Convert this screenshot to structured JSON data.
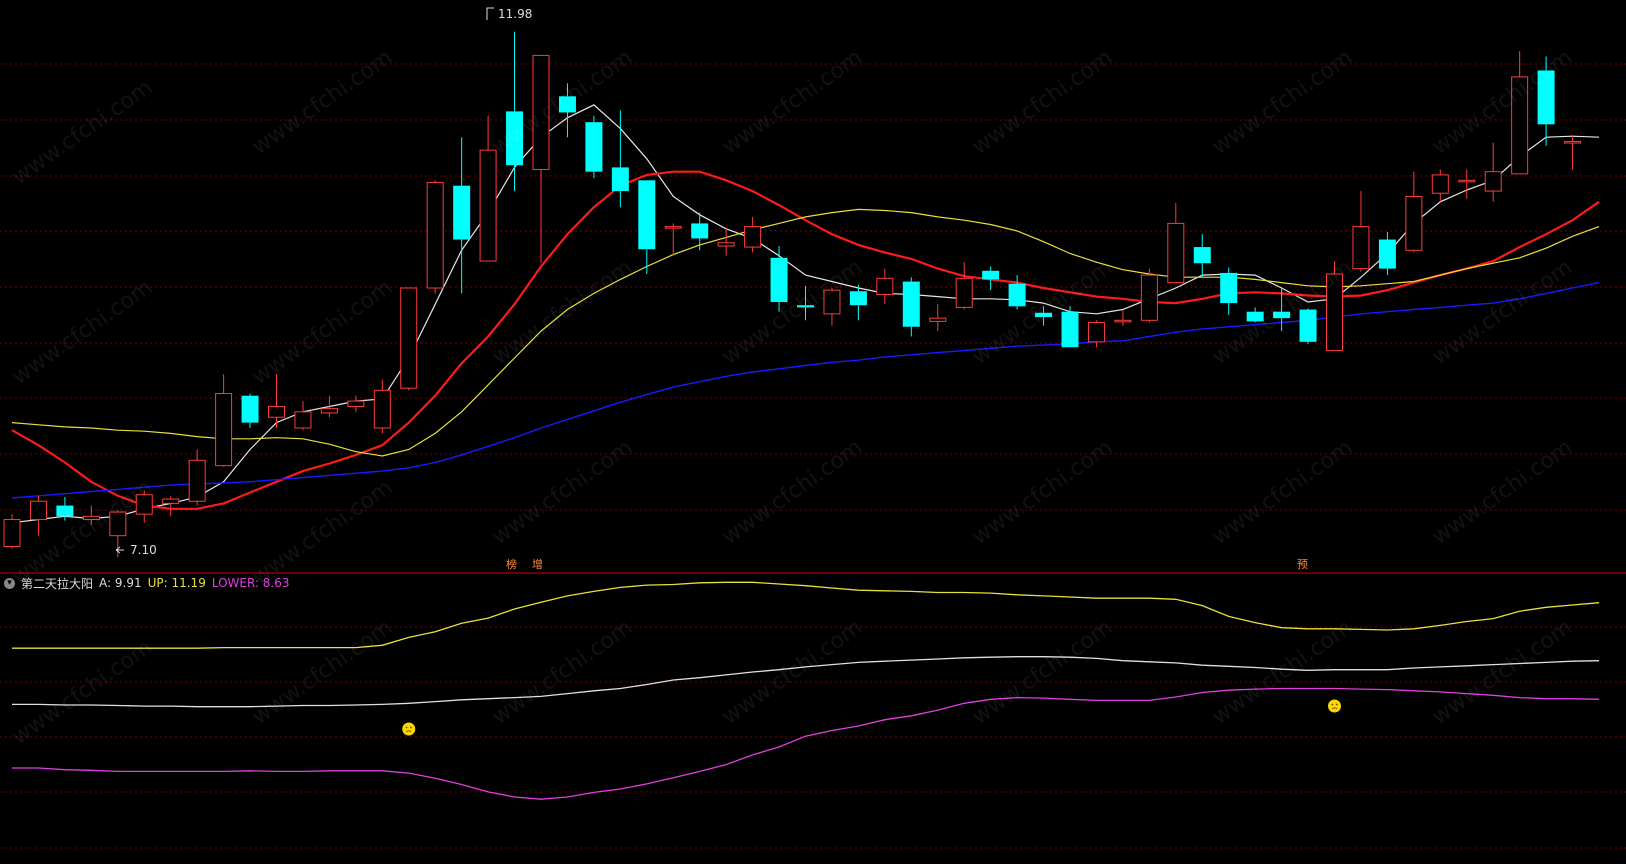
{
  "colors": {
    "background": "#000000",
    "up_candle": "#ff3b3b",
    "down_candle": "#00ffff",
    "ma_white": "#e6e6e6",
    "ma_red": "#ff1a1a",
    "ma_yellow": "#e8e03a",
    "ma_blue": "#1a1aff",
    "grid": "#7a0000",
    "divider": "#8b0000",
    "upper": "#e8e03a",
    "mid": "#e0e0e0",
    "lower": "#e040e0",
    "smiley": "#ffd700"
  },
  "annotations": {
    "high_label": "11.98",
    "low_label": "7.10"
  },
  "markers": [
    "榜",
    "增",
    "预"
  ],
  "indicator": {
    "name": "第二天拉大阳",
    "a_label": "A: 9.91",
    "up_label": "UP: 11.19",
    "lower_label": "LOWER: 8.63"
  },
  "watermark": "www.cfchi.com",
  "chart_data": [
    {
      "type": "candlestick",
      "ylim": [
        7.0,
        12.2
      ],
      "grid": true,
      "candles": [
        [
          7.2,
          7.45,
          7.18,
          7.5
        ],
        [
          7.45,
          7.62,
          7.3,
          7.67
        ],
        [
          7.58,
          7.48,
          7.44,
          7.66
        ],
        [
          7.45,
          7.48,
          7.4,
          7.58
        ],
        [
          7.3,
          7.52,
          7.1,
          7.54
        ],
        [
          7.5,
          7.68,
          7.42,
          7.72
        ],
        [
          7.6,
          7.64,
          7.48,
          7.67
        ],
        [
          7.62,
          8.0,
          7.58,
          8.1
        ],
        [
          7.95,
          8.62,
          7.94,
          8.8
        ],
        [
          8.6,
          8.35,
          8.3,
          8.62
        ],
        [
          8.4,
          8.5,
          8.3,
          8.8
        ],
        [
          8.3,
          8.45,
          8.28,
          8.55
        ],
        [
          8.44,
          8.48,
          8.4,
          8.6
        ],
        [
          8.5,
          8.55,
          8.45,
          8.6
        ],
        [
          8.3,
          8.65,
          8.25,
          8.75
        ],
        [
          8.67,
          9.6,
          8.65,
          9.6
        ],
        [
          9.6,
          10.58,
          9.55,
          10.6
        ],
        [
          10.55,
          10.05,
          9.55,
          11.0
        ],
        [
          9.85,
          10.88,
          9.85,
          11.2
        ],
        [
          11.24,
          10.74,
          10.5,
          11.98
        ],
        [
          10.7,
          11.76,
          9.83,
          11.76
        ],
        [
          11.38,
          11.23,
          11.0,
          11.5
        ],
        [
          11.14,
          10.68,
          10.62,
          11.2
        ],
        [
          10.72,
          10.5,
          10.35,
          11.25
        ],
        [
          10.6,
          9.96,
          9.73,
          10.6
        ],
        [
          10.17,
          10.17,
          9.9,
          10.2
        ],
        [
          10.2,
          10.06,
          9.95,
          10.3
        ],
        [
          9.99,
          10.02,
          9.9,
          10.15
        ],
        [
          9.98,
          10.17,
          9.93,
          10.26
        ],
        [
          9.88,
          9.47,
          9.38,
          9.99
        ],
        [
          9.44,
          9.42,
          9.3,
          9.62
        ],
        [
          9.36,
          9.58,
          9.25,
          9.6
        ],
        [
          9.57,
          9.44,
          9.3,
          9.63
        ],
        [
          9.54,
          9.69,
          9.45,
          9.78
        ],
        [
          9.66,
          9.24,
          9.15,
          9.7
        ],
        [
          9.29,
          9.32,
          9.2,
          9.45
        ],
        [
          9.42,
          9.69,
          9.4,
          9.84
        ],
        [
          9.76,
          9.68,
          9.58,
          9.8
        ],
        [
          9.64,
          9.43,
          9.4,
          9.72
        ],
        [
          9.37,
          9.33,
          9.25,
          9.43
        ],
        [
          9.38,
          9.05,
          9.05,
          9.43
        ],
        [
          9.1,
          9.28,
          9.05,
          9.3
        ],
        [
          9.29,
          9.3,
          9.25,
          9.39
        ],
        [
          9.3,
          9.72,
          9.28,
          9.78
        ],
        [
          9.65,
          10.2,
          9.64,
          10.39
        ],
        [
          9.98,
          9.83,
          9.7,
          10.1
        ],
        [
          9.74,
          9.46,
          9.35,
          9.79
        ],
        [
          9.38,
          9.29,
          9.28,
          9.42
        ],
        [
          9.38,
          9.32,
          9.2,
          9.6
        ],
        [
          9.4,
          9.1,
          9.08,
          9.41
        ],
        [
          9.02,
          9.73,
          9.02,
          9.85
        ],
        [
          9.78,
          10.17,
          9.75,
          10.5
        ],
        [
          10.05,
          9.78,
          9.72,
          10.12
        ],
        [
          9.95,
          10.45,
          9.93,
          10.68
        ],
        [
          10.48,
          10.65,
          10.4,
          10.7
        ],
        [
          10.6,
          10.6,
          10.43,
          10.7
        ],
        [
          10.5,
          10.68,
          10.4,
          10.95
        ],
        [
          10.66,
          11.56,
          10.66,
          11.8
        ],
        [
          11.62,
          11.12,
          10.92,
          11.75
        ],
        [
          10.96,
          10.96,
          10.7,
          11.02
        ]
      ],
      "series": [
        {
          "kind": "ma_white",
          "values": [
            7.42,
            7.45,
            7.48,
            7.46,
            7.48,
            7.55,
            7.6,
            7.66,
            7.8,
            8.1,
            8.35,
            8.45,
            8.5,
            8.55,
            8.57,
            8.95,
            9.45,
            9.95,
            10.3,
            10.72,
            11.0,
            11.18,
            11.3,
            11.08,
            10.8,
            10.45,
            10.28,
            10.15,
            10.06,
            9.9,
            9.72,
            9.66,
            9.6,
            9.55,
            9.54,
            9.52,
            9.5,
            9.5,
            9.49,
            9.46,
            9.38,
            9.36,
            9.4,
            9.5,
            9.6,
            9.72,
            9.73,
            9.72,
            9.6,
            9.47,
            9.5,
            9.7,
            9.92,
            10.2,
            10.4,
            10.51,
            10.6,
            10.82,
            11.0,
            11.01,
            11.0
          ]
        },
        {
          "kind": "ma_red",
          "values": [
            8.28,
            8.14,
            7.98,
            7.8,
            7.67,
            7.58,
            7.55,
            7.55,
            7.6,
            7.7,
            7.8,
            7.9,
            7.97,
            8.05,
            8.14,
            8.35,
            8.6,
            8.9,
            9.15,
            9.45,
            9.8,
            10.1,
            10.35,
            10.55,
            10.65,
            10.68,
            10.68,
            10.6,
            10.5,
            10.37,
            10.23,
            10.1,
            10.0,
            9.93,
            9.87,
            9.78,
            9.71,
            9.68,
            9.65,
            9.6,
            9.56,
            9.52,
            9.5,
            9.47,
            9.46,
            9.5,
            9.55,
            9.56,
            9.55,
            9.53,
            9.52,
            9.53,
            9.58,
            9.65,
            9.72,
            9.78,
            9.85,
            9.98,
            10.1,
            10.23,
            10.4
          ]
        },
        {
          "kind": "ma_yellow",
          "values": [
            8.35,
            8.33,
            8.31,
            8.3,
            8.28,
            8.27,
            8.25,
            8.22,
            8.2,
            8.2,
            8.21,
            8.2,
            8.15,
            8.08,
            8.04,
            8.1,
            8.25,
            8.45,
            8.7,
            8.95,
            9.2,
            9.4,
            9.55,
            9.68,
            9.8,
            9.91,
            10.0,
            10.07,
            10.14,
            10.2,
            10.26,
            10.3,
            10.33,
            10.32,
            10.3,
            10.26,
            10.23,
            10.19,
            10.13,
            10.03,
            9.92,
            9.84,
            9.77,
            9.73,
            9.7,
            9.7,
            9.7,
            9.68,
            9.65,
            9.62,
            9.61,
            9.62,
            9.64,
            9.66,
            9.72,
            9.78,
            9.83,
            9.88,
            9.97,
            10.08,
            10.17
          ]
        },
        {
          "kind": "ma_blue",
          "values": [
            7.65,
            7.67,
            7.69,
            7.71,
            7.73,
            7.75,
            7.77,
            7.78,
            7.79,
            7.8,
            7.82,
            7.84,
            7.86,
            7.88,
            7.9,
            7.93,
            7.98,
            8.05,
            8.13,
            8.21,
            8.3,
            8.38,
            8.46,
            8.54,
            8.61,
            8.68,
            8.73,
            8.78,
            8.82,
            8.85,
            8.88,
            8.91,
            8.93,
            8.96,
            8.98,
            9.0,
            9.02,
            9.04,
            9.06,
            9.07,
            9.08,
            9.1,
            9.11,
            9.15,
            9.19,
            9.22,
            9.24,
            9.26,
            9.28,
            9.3,
            9.33,
            9.36,
            9.38,
            9.4,
            9.42,
            9.44,
            9.46,
            9.5,
            9.55,
            9.6,
            9.65
          ]
        }
      ]
    },
    {
      "type": "line",
      "name": "第二天拉大阳",
      "ylim": [
        7.0,
        12.0
      ],
      "grid": true,
      "series": [
        {
          "name": "UP",
          "values": [
            10.8,
            10.8,
            10.8,
            10.8,
            10.8,
            10.8,
            10.8,
            10.8,
            10.81,
            10.81,
            10.81,
            10.81,
            10.81,
            10.81,
            10.85,
            10.99,
            11.09,
            11.24,
            11.33,
            11.49,
            11.61,
            11.72,
            11.8,
            11.87,
            11.91,
            11.92,
            11.95,
            11.96,
            11.96,
            11.93,
            11.9,
            11.86,
            11.82,
            11.81,
            11.8,
            11.78,
            11.78,
            11.77,
            11.74,
            11.72,
            11.7,
            11.68,
            11.68,
            11.68,
            11.66,
            11.55,
            11.36,
            11.25,
            11.16,
            11.14,
            11.14,
            11.13,
            11.12,
            11.14,
            11.2,
            11.27,
            11.32,
            11.45,
            11.52,
            11.56,
            11.6
          ]
        },
        {
          "name": "A",
          "values": [
            9.81,
            9.81,
            9.8,
            9.8,
            9.79,
            9.78,
            9.78,
            9.77,
            9.77,
            9.77,
            9.78,
            9.79,
            9.79,
            9.8,
            9.81,
            9.83,
            9.86,
            9.89,
            9.91,
            9.93,
            9.95,
            10.0,
            10.05,
            10.09,
            10.16,
            10.24,
            10.28,
            10.33,
            10.38,
            10.42,
            10.47,
            10.51,
            10.55,
            10.57,
            10.59,
            10.61,
            10.63,
            10.64,
            10.65,
            10.65,
            10.64,
            10.62,
            10.58,
            10.56,
            10.54,
            10.5,
            10.48,
            10.46,
            10.43,
            10.41,
            10.42,
            10.42,
            10.42,
            10.45,
            10.47,
            10.49,
            10.51,
            10.53,
            10.55,
            10.57,
            10.58
          ]
        },
        {
          "name": "LOWER",
          "values": [
            8.69,
            8.69,
            8.66,
            8.65,
            8.63,
            8.63,
            8.63,
            8.63,
            8.63,
            8.64,
            8.63,
            8.63,
            8.64,
            8.64,
            8.64,
            8.6,
            8.51,
            8.4,
            8.27,
            8.18,
            8.14,
            8.18,
            8.26,
            8.32,
            8.41,
            8.52,
            8.63,
            8.75,
            8.92,
            9.06,
            9.25,
            9.35,
            9.43,
            9.54,
            9.61,
            9.71,
            9.83,
            9.9,
            9.93,
            9.92,
            9.9,
            9.88,
            9.88,
            9.88,
            9.94,
            10.02,
            10.06,
            10.08,
            10.09,
            10.09,
            10.09,
            10.08,
            10.07,
            10.05,
            10.03,
            10.0,
            9.97,
            9.93,
            9.91,
            9.91,
            9.9
          ]
        }
      ],
      "face_markers_x": [
        15,
        50
      ]
    }
  ]
}
